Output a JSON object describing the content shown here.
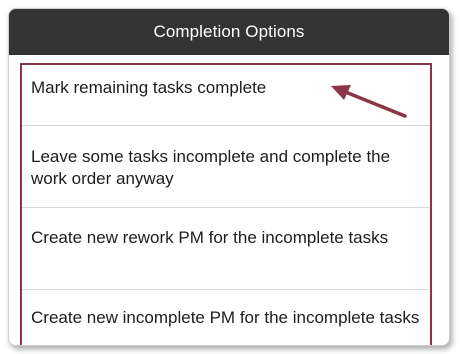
{
  "dialog": {
    "title": "Completion Options",
    "options": [
      {
        "label": "Mark remaining tasks complete"
      },
      {
        "label": "Leave some tasks incomplete and complete the work order anyway"
      },
      {
        "label": "Create new rework PM for the incomplete tasks"
      },
      {
        "label": "Create new incomplete PM for the incomplete tasks"
      }
    ]
  },
  "annotation": {
    "highlight_color": "#8d3547",
    "arrow_color": "#8d3547"
  }
}
